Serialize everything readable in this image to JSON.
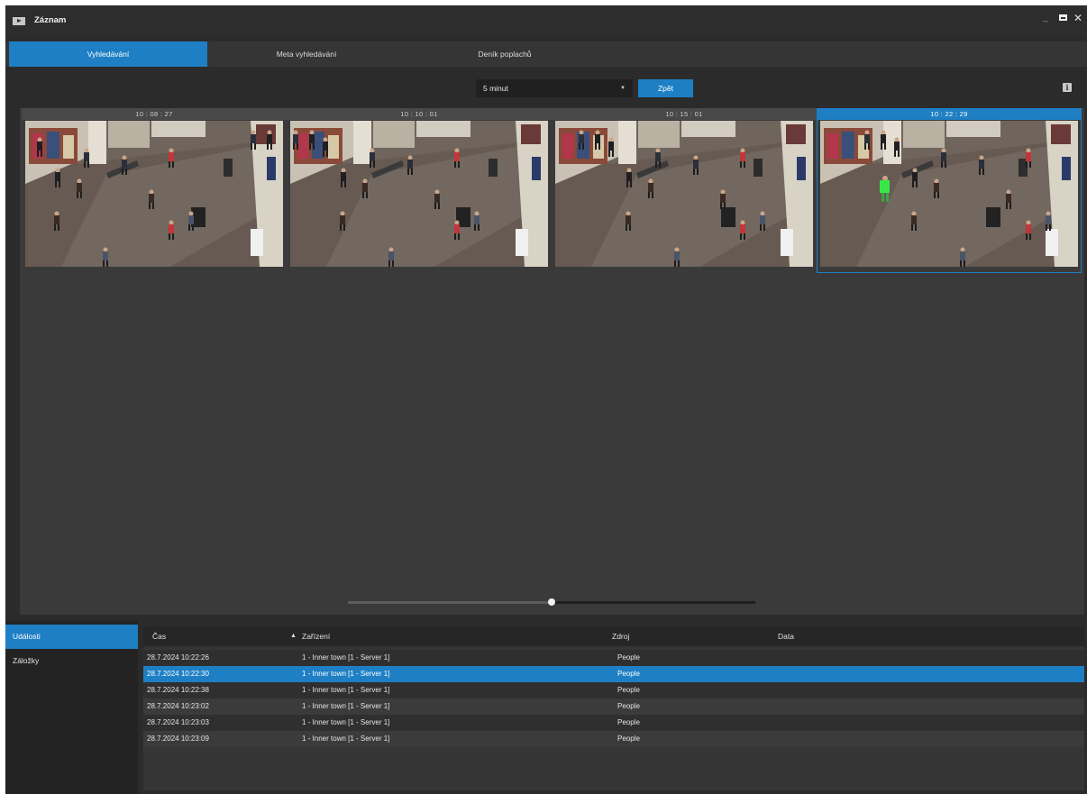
{
  "window": {
    "title": "Záznam",
    "app_icon": "video-play-icon",
    "controls": {
      "minimize": "_",
      "close": "✕"
    }
  },
  "tabs": [
    {
      "label": "Vyhledávání",
      "active": true
    },
    {
      "label": "Meta vyhledávání",
      "active": false
    },
    {
      "label": "Deník poplachů",
      "active": false
    }
  ],
  "toolbar": {
    "time_range": {
      "value": "5 minut",
      "caret": "▼"
    },
    "back_label": "Zpět",
    "info_icon": "i"
  },
  "thumbnails": [
    {
      "time": "10 : 08 : 27",
      "selected": false
    },
    {
      "time": "10 : 10 : 01",
      "selected": false
    },
    {
      "time": "10 : 15 : 01",
      "selected": false
    },
    {
      "time": "10 : 22 : 29",
      "selected": true
    }
  ],
  "timeline": {
    "position_fraction": 0.5
  },
  "side_panel": {
    "items": [
      {
        "label": "Události",
        "active": true
      },
      {
        "label": "Záložky",
        "active": false
      }
    ]
  },
  "events": {
    "columns": [
      {
        "label": "Čas"
      },
      {
        "label": "Zařízení",
        "sort": "ascending"
      },
      {
        "label": "Zdroj"
      },
      {
        "label": "Data"
      }
    ],
    "sort_icon": "▲",
    "rows": [
      {
        "time": "28.7.2024 10:22:26",
        "device": "1 - Inner town [1 - Server 1]",
        "source": "People",
        "data": ""
      },
      {
        "time": "28.7.2024 10:22:30",
        "device": "1 - Inner town [1 - Server 1]",
        "source": "People",
        "data": "",
        "selected": true
      },
      {
        "time": "28.7.2024 10:22:38",
        "device": "1 - Inner town [1 - Server 1]",
        "source": "People",
        "data": ""
      },
      {
        "time": "28.7.2024 10:23:02",
        "device": "1 - Inner town [1 - Server 1]",
        "source": "People",
        "data": ""
      },
      {
        "time": "28.7.2024 10:23:03",
        "device": "1 - Inner town [1 - Server 1]",
        "source": "People",
        "data": ""
      },
      {
        "time": "28.7.2024 10:23:09",
        "device": "1 - Inner town [1 - Server 1]",
        "source": "People",
        "data": ""
      }
    ]
  },
  "colors": {
    "accent": "#1e7fc4",
    "background": "#2b2b2b",
    "panel": "#3a3a3a"
  }
}
